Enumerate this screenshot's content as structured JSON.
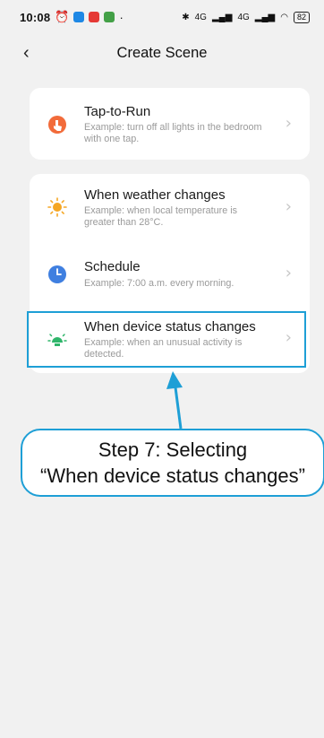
{
  "status_bar": {
    "time": "10:08",
    "dot": "·",
    "network_label": "4G",
    "battery": "82",
    "app_icon_colors": [
      "#1e88e5",
      "#e53935",
      "#43a047"
    ]
  },
  "header": {
    "title": "Create Scene",
    "back_icon": "chevron-left-icon"
  },
  "card_tap": {
    "items": [
      {
        "name": "Tap-to-Run",
        "description": "Example: turn off all lights in the bedroom with one tap.",
        "icon": "hand-tap-icon"
      }
    ]
  },
  "card_conditions": {
    "items": [
      {
        "name": "When weather changes",
        "description": "Example: when local temperature is greater than 28°C.",
        "icon": "sun-icon"
      },
      {
        "name": "Schedule",
        "description": "Example: 7:00 a.m. every morning.",
        "icon": "clock-icon"
      },
      {
        "name": "When device status changes",
        "description": "Example: when an unusual activity is detected.",
        "icon": "device-bulb-icon"
      }
    ]
  },
  "annotation": {
    "line1": "Step 7: Selecting",
    "line2": "“When device status changes”",
    "color": "#1e9fd6"
  },
  "colors": {
    "background": "#f1f1f1",
    "tap_icon": "#f26b3a",
    "sun_icon": "#f5a623",
    "clock_icon": "#3f7fe0",
    "device_icon": "#2fb56a"
  }
}
